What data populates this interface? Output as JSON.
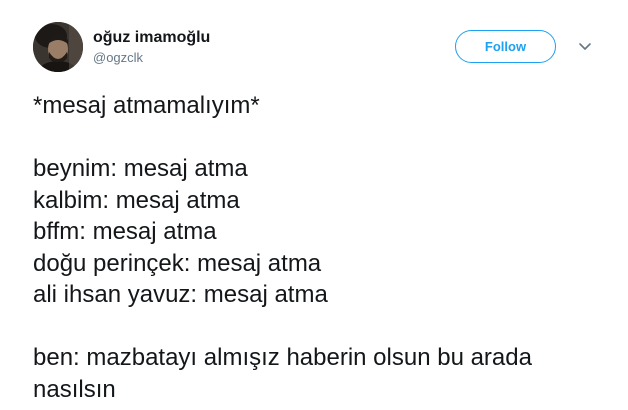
{
  "user": {
    "display_name": "oğuz imamoğlu",
    "handle": "@ogzclk",
    "avatar_icon": "profile-photo"
  },
  "actions": {
    "follow_label": "Follow",
    "more_icon": "chevron-down-icon"
  },
  "tweet": {
    "intro": "*mesaj atmamalıyım*",
    "lines": [
      "beynim: mesaj atma",
      "kalbim: mesaj atma",
      "bffm: mesaj atma",
      "doğu perinçek: mesaj atma",
      "ali ihsan yavuz: mesaj atma"
    ],
    "closing": "ben: mazbatayı almışız haberin olsun bu arada nasılsın"
  },
  "colors": {
    "accent": "#1da1f2",
    "text": "#14171a",
    "secondary": "#657786"
  }
}
